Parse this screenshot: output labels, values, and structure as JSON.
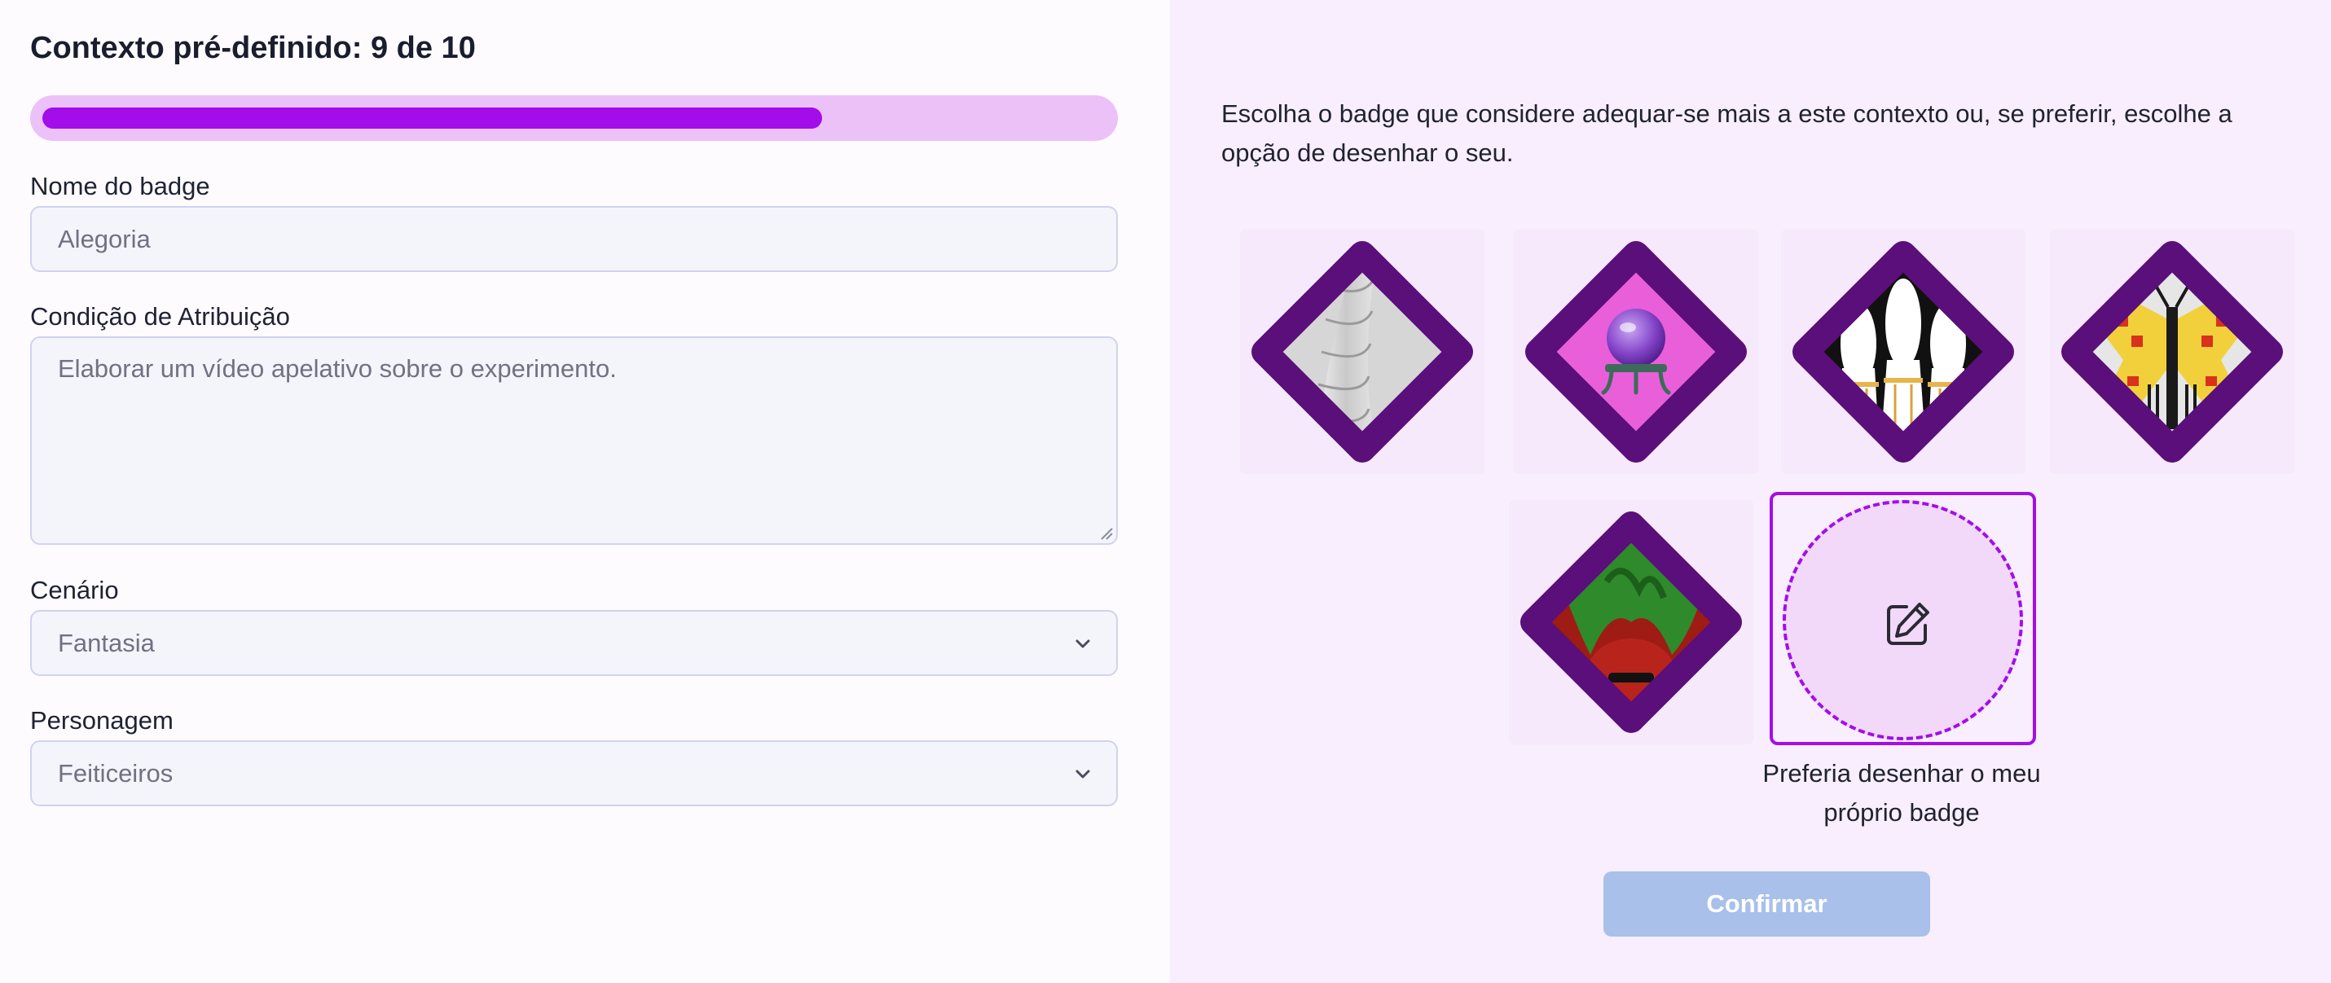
{
  "left": {
    "title": "Contexto pré-definido: 9 de 10",
    "progress": {
      "current": 9,
      "total": 10,
      "fill_color": "#a30ceb",
      "track_color": "#ecc1f8"
    },
    "badge_name": {
      "label": "Nome do badge",
      "placeholder": "Alegoria"
    },
    "condition": {
      "label": "Condição de Atribuição",
      "placeholder": "Elaborar um vídeo apelativo sobre o experimento."
    },
    "scenario": {
      "label": "Cenário",
      "selected": "Fantasia"
    },
    "character": {
      "label": "Personagem",
      "selected": "Feiticeiros"
    }
  },
  "right": {
    "instructions": "Escolha o badge que considere adequar-se mais a este contexto ou, se preferir, escolhe a opção de desenhar o seu.",
    "badges": [
      {
        "name": "spiral-shell-badge"
      },
      {
        "name": "crystal-ball-badge"
      },
      {
        "name": "dancers-badge"
      },
      {
        "name": "butterfly-badge"
      },
      {
        "name": "red-green-creature-badge"
      }
    ],
    "badge_border_color": "#5a0f7a",
    "draw_option": {
      "caption": "Preferia desenhar o meu próprio badge",
      "icon": "edit-icon"
    },
    "confirm_button": {
      "label": "Confirmar",
      "disabled": true,
      "color": "#a8c0ea"
    }
  }
}
